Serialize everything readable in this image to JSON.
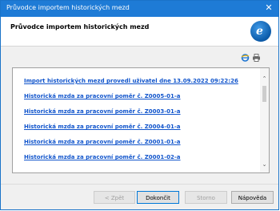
{
  "window": {
    "title": "Průvodce importem historických mezd"
  },
  "header": {
    "title": "Průvodce importem historických mezd",
    "logo_icon": "app-logo-icon"
  },
  "toolbar": {
    "icons": [
      "internet-explorer-icon",
      "printer-icon"
    ]
  },
  "content": {
    "links": [
      "Import historických mezd provedl uživatel dne 13.09.2022 09:22:26",
      "Historická mzda za pracovní poměr č. Z0005-01-a",
      "Historická mzda za pracovní poměr č. Z0003-01-a",
      "Historická mzda za pracovní poměr č. Z0004-01-a",
      "Historická mzda za pracovní poměr č. Z0001-01-a",
      "Historická mzda za pracovní poměr č. Z0001-02-a"
    ]
  },
  "buttons": {
    "back": "< Zpět",
    "finish": "Dokončit",
    "cancel": "Storno",
    "help": "Nápověda"
  },
  "colors": {
    "titlebar": "#1e7bd6",
    "link": "#1155cc"
  }
}
